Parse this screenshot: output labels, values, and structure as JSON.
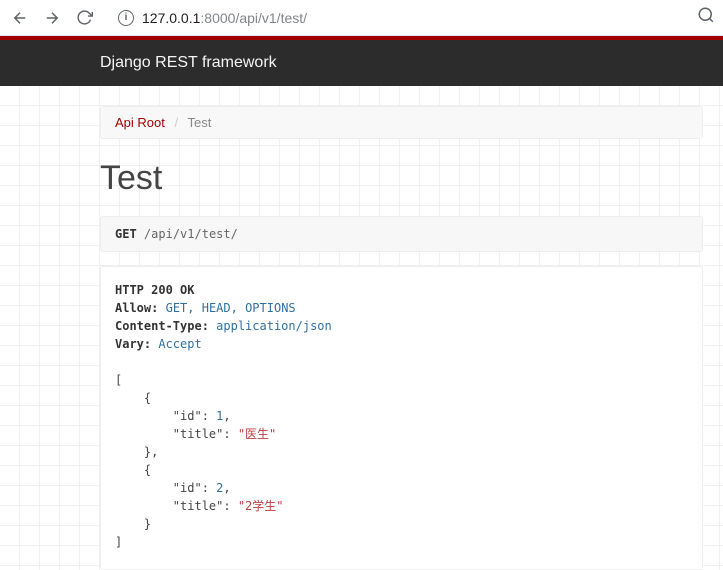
{
  "browser": {
    "url_host": "127.0.0.1",
    "url_port": ":8000",
    "url_path": "/api/v1/test/"
  },
  "navbar": {
    "brand": "Django REST framework"
  },
  "breadcrumb": {
    "root_label": "Api Root",
    "separator": "/",
    "current": "Test"
  },
  "page": {
    "title": "Test"
  },
  "request": {
    "method": "GET",
    "path": "/api/v1/test/"
  },
  "response": {
    "status_line": "HTTP 200 OK",
    "headers": {
      "allow_key": "Allow:",
      "allow_val": "GET, HEAD, OPTIONS",
      "content_type_key": "Content-Type:",
      "content_type_val": "application/json",
      "vary_key": "Vary:",
      "vary_val": "Accept"
    },
    "body": [
      {
        "id": 1,
        "title": "医生"
      },
      {
        "id": 2,
        "title": "2学生"
      }
    ],
    "body_keys": {
      "id": "\"id\"",
      "title": "\"title\""
    },
    "body_vals": {
      "id0": "1",
      "title0": "\"医生\"",
      "id1": "2",
      "title1": "\"2学生\""
    }
  }
}
